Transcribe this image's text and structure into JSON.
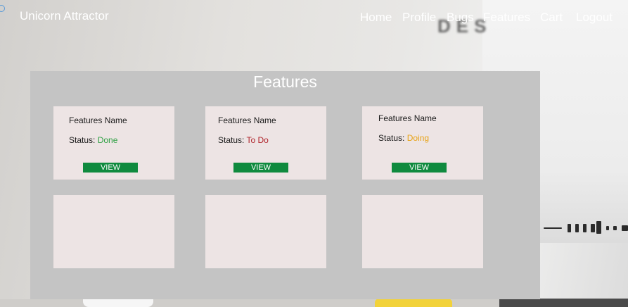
{
  "brand": "Unicorn Attractor",
  "nav": [
    "Home",
    "Profile",
    "Bugs",
    "Features",
    "Cart",
    "Logout"
  ],
  "page_title": "Features",
  "status_label": "Status:",
  "cards": [
    {
      "name": "Features Name",
      "status": "Done",
      "status_color": "#2ea043",
      "button": "VIEW"
    },
    {
      "name": "Features Name",
      "status": "To Do",
      "status_color": "#b0242b",
      "button": "VIEW"
    },
    {
      "name": "Features Name",
      "status": "Doing",
      "status_color": "#e8a317",
      "button": "VIEW"
    }
  ],
  "colors": {
    "panel": "#c4c4c4",
    "card": "#ede4e4",
    "button": "#0f8a3e"
  }
}
